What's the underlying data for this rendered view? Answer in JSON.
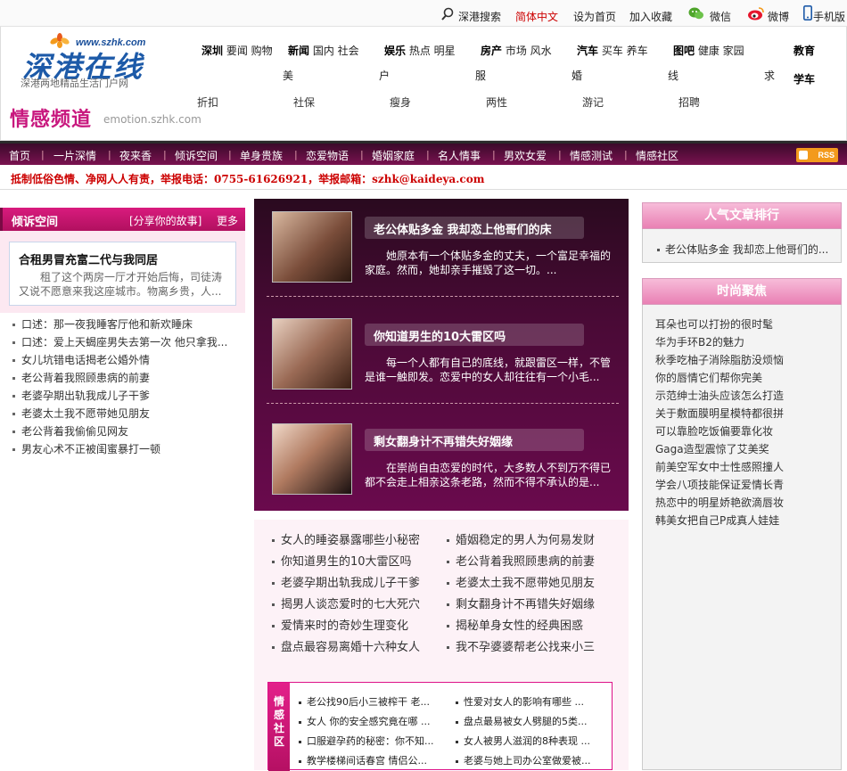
{
  "topbar": {
    "items": [
      {
        "label": "深港搜索",
        "icon": "search-icon"
      },
      {
        "label": "简体中文",
        "color": "#cc0000"
      },
      {
        "label": "设为首页"
      },
      {
        "label": "加入收藏"
      },
      {
        "label": "微信",
        "icon": "wechat-icon"
      },
      {
        "label": "微博",
        "icon": "weibo-icon"
      },
      {
        "label": "手机版",
        "icon": "phone-icon"
      }
    ]
  },
  "header": {
    "logo_url": "www.szhk.com",
    "logo_main": "深港在线",
    "logo_sub": "深港两地精品生活门户网",
    "channel_title": "情感频道",
    "channel_url": "emotion.szhk.com",
    "nav_row1": [
      {
        "head": "深圳",
        "items": "要闻 购物"
      },
      {
        "head": "新闻",
        "items": "国内 社会"
      },
      {
        "head": "娱乐",
        "items": "热点 明星"
      },
      {
        "head": "房产",
        "items": "市场 风水"
      },
      {
        "head": "汽车",
        "items": "买车 养车"
      },
      {
        "head": "图吧",
        "items": "健康 家园"
      },
      {
        "head": "教育",
        "items": ""
      }
    ],
    "nav_row2": [
      "美",
      "户",
      "服",
      "婚",
      "线",
      "求",
      "学车"
    ],
    "nav_row3": [
      "折扣",
      "社保",
      "瘦身",
      "两性",
      "游记",
      "招聘"
    ]
  },
  "menu": {
    "items": [
      "首页",
      "一片深情",
      "夜来香",
      "倾诉空间",
      "单身贵族",
      "恋爱物语",
      "婚姻家庭",
      "名人情事",
      "男欢女爱",
      "情感测试",
      "情感社区"
    ],
    "rss": "RSS"
  },
  "notice": "抵制低俗色情、净网人人有责，举报电话：0755-61626921，举报邮箱：szhk@kaideya.com",
  "left": {
    "title": "倾诉空间",
    "subtitle": "[分享你的故事]",
    "more": "更多",
    "feature_title": "合租男冒充富二代与我同居",
    "feature_desc": "租了这个两房一厅才开始后悔，司徒涛又说不愿意来我这座城市。物离乡贵，人...",
    "list": [
      "口述：那一夜我睡客厅他和新欢睡床",
      "口述：爱上天蝎座男失去第一次 他只拿我...",
      "女儿坑错电话揭老公婚外情",
      "老公背着我照顾患病的前妻",
      "老婆孕期出轨我成儿子干爹",
      "老婆太土我不愿带她见朋友",
      "老公背着我偷偷见网友",
      "男友心术不正被闺蜜暴打一顿"
    ]
  },
  "middle": {
    "stories": [
      {
        "title": "老公体贴多金 我却恋上他哥们的床",
        "desc": "她原本有一个体贴多金的丈夫，一个富足幸福的家庭。然而，她却亲手摧毁了这一切。..."
      },
      {
        "title": "你知道男生的10大雷区吗",
        "desc": "每一个人都有自己的底线，就跟雷区一样，不管是谁一触即发。恋爱中的女人却往往有一个小毛..."
      },
      {
        "title": "剩女翻身计不再错失好姻缘",
        "desc": "在崇尚自由恋爱的时代，大多数人不到万不得已都不会走上相亲这条老路，然而不得不承认的是..."
      }
    ],
    "list_left": [
      "女人的睡姿暴露哪些小秘密",
      "你知道男生的10大雷区吗",
      "老婆孕期出轨我成儿子干爹",
      "揭男人谈恋爱时的七大死穴",
      "爱情来时的奇妙生理变化",
      "盘点最容易离婚十六种女人"
    ],
    "list_right": [
      "婚姻稳定的男人为何易发财",
      "老公背着我照顾患病的前妻",
      "老婆太土我不愿带她见朋友",
      "剩女翻身计不再错失好姻缘",
      "揭秘单身女性的经典困惑",
      "我不孕婆婆帮老公找来小三"
    ],
    "community_label": "情感社区",
    "community_left": [
      "老公找90后小三被榨干 老...",
      "女人 你的安全感究竟在哪 ...",
      "口服避孕药的秘密：你不知...",
      "教学楼梯间话春宫 情侣公..."
    ],
    "community_right": [
      "性爱对女人的影响有哪些 ...",
      "盘点最易被女人劈腿的5类...",
      "女人被男人滋润的8种表现 ...",
      "老婆与她上司办公室做爱被..."
    ]
  },
  "right": {
    "rank_title": "人气文章排行",
    "rank_items": [
      "老公体贴多金 我却恋上他哥们的..."
    ],
    "fashion_title": "时尚聚焦",
    "fashion_items": [
      "耳朵也可以打扮的很时髦",
      "华为手环B2的魅力",
      "秋季吃柚子消除脂肪没烦恼",
      "你的唇情它们帮你完美",
      "示范绅士油头应该怎么打造",
      "关于敷面膜明星模特都很拼",
      "可以靠脸吃饭偏要靠化妆",
      "Gaga造型震惊了艾美奖",
      "前美空军女中士性感照撞人",
      "学会八项技能保证爱情长青",
      "热恋中的明星娇艳欲滴唇妆",
      "韩美女把自己P成真人娃娃"
    ]
  },
  "colors": {
    "brand": "#c8187e",
    "menu": "#5a0c3e",
    "notice": "#cc0000",
    "logo": "#1d5aa8"
  }
}
